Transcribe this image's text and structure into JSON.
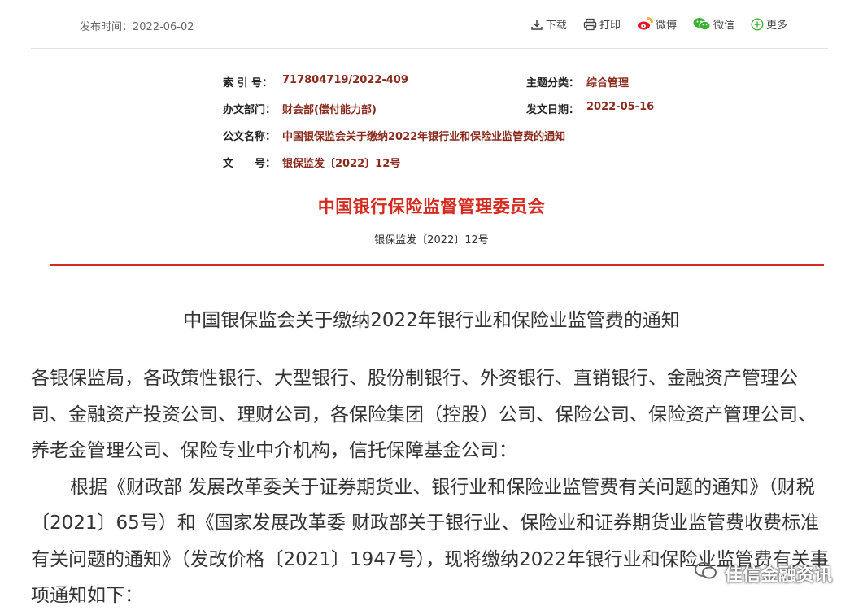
{
  "header": {
    "publish_time": "发布时间：2022-06-02",
    "actions": [
      {
        "icon": "download-icon",
        "label": "下载"
      },
      {
        "icon": "print-icon",
        "label": "打印"
      },
      {
        "icon": "weibo-icon",
        "label": "微博"
      },
      {
        "icon": "wechat-icon",
        "label": "微信"
      },
      {
        "icon": "plus-circle-icon",
        "label": "更多"
      }
    ]
  },
  "meta": {
    "index_label": "索 引 号：",
    "index_value": "717804719/2022-409",
    "category_label": "主题分类：",
    "category_value": "综合管理",
    "dept_label": "办文部门：",
    "dept_value": "财会部(偿付能力部)",
    "date_label": "发文日期：",
    "date_value": "2022-05-16",
    "name_label": "公文名称：",
    "name_value": "中国银保监会关于缴纳2022年银行业和保险业监管费的通知",
    "docno_label": "文　　号：",
    "docno_value": "银保监发〔2022〕12号"
  },
  "document": {
    "issuer": "中国银行保险监督管理委员会",
    "doc_number": "银保监发〔2022〕12号",
    "title": "中国银保监会关于缴纳2022年银行业和保险业监管费的通知",
    "addressees": "各银保监局，各政策性银行、大型银行、股份制银行、外资银行、直销银行、金融资产管理公司、金融资产投资公司、理财公司，各保险集团（控股）公司、保险公司、保险资产管理公司、养老金管理公司、保险专业中介机构，信托保障基金公司：",
    "paragraph1": "根据《财政部 发展改革委关于证券期货业、银行业和保险业监管费有关问题的通知》（财税〔2021〕65号）和《国家发展改革委 财政部关于银行业、保险业和证券期货业监管费收费标准有关问题的通知》（发改价格〔2021〕1947号），现将缴纳2022年银行业和保险业监管费有关事项通知如下："
  },
  "watermark": {
    "brand": "佳信金融资讯"
  }
}
